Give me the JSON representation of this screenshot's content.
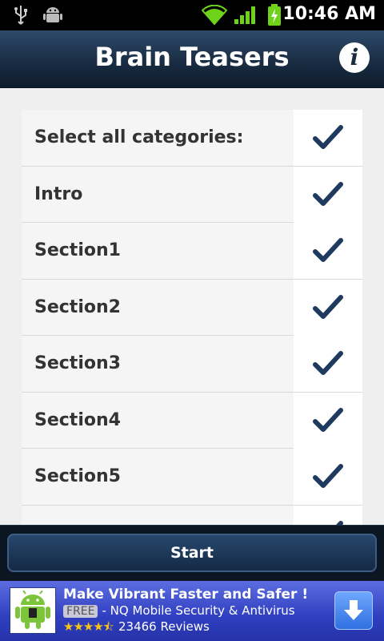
{
  "status_bar": {
    "time": "10:46 AM",
    "icons": [
      "usb-icon",
      "android-debug-icon",
      "wifi-icon",
      "signal-icon",
      "battery-charging-icon"
    ]
  },
  "header": {
    "title": "Brain Teasers",
    "info_icon": "info-icon"
  },
  "categories": {
    "items": [
      {
        "label": "Select all categories:",
        "checked": true
      },
      {
        "label": "Intro",
        "checked": true
      },
      {
        "label": "Section1",
        "checked": true
      },
      {
        "label": "Section2",
        "checked": true
      },
      {
        "label": "Section3",
        "checked": true
      },
      {
        "label": "Section4",
        "checked": true
      },
      {
        "label": "Section5",
        "checked": true
      },
      {
        "label": "",
        "checked": true
      }
    ]
  },
  "footer": {
    "start_label": "Start"
  },
  "ad": {
    "title": "Make Vibrant Faster and Safer !",
    "badge": "FREE",
    "subtitle": "- NQ Mobile Security & Antivirus",
    "rating": 4.5,
    "reviews": "23466 Reviews"
  },
  "colors": {
    "check": "#1f3a5f",
    "header_bg": "#1a2d44",
    "ad_bg": "#2f3fc0"
  }
}
